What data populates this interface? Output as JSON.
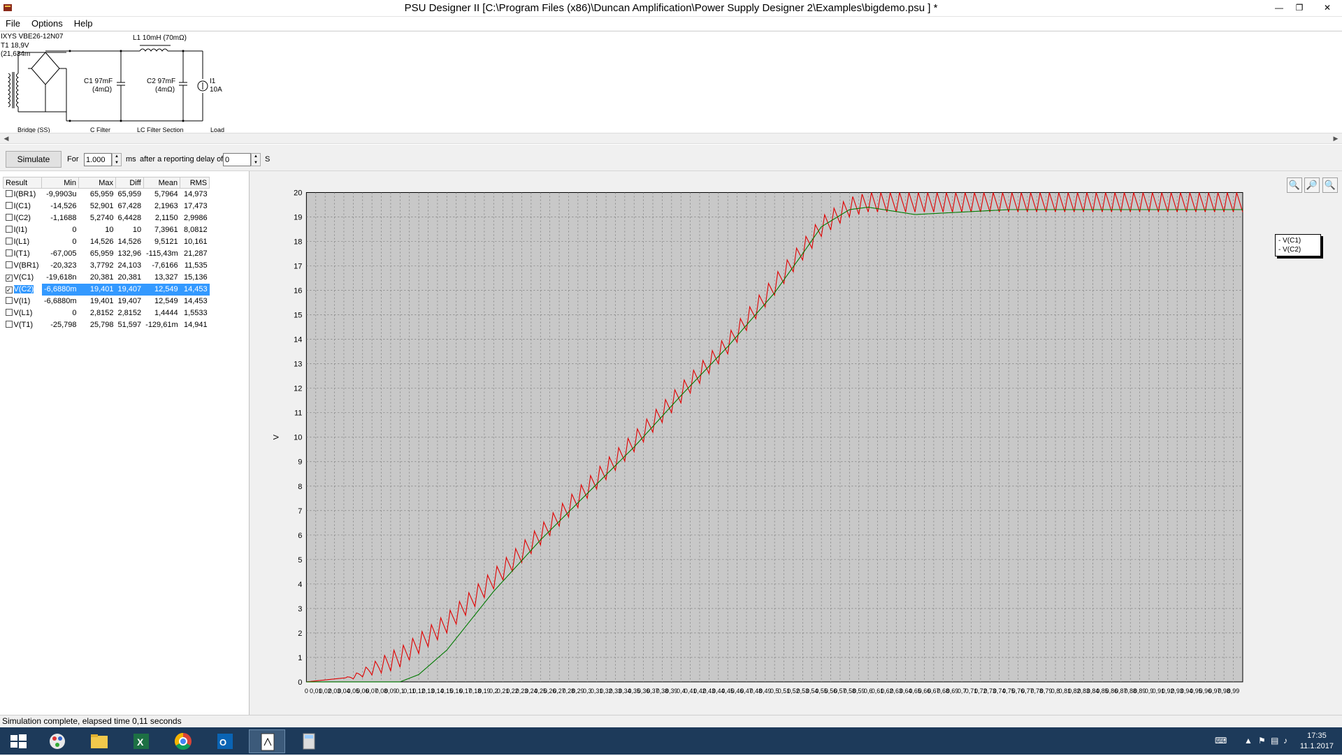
{
  "window": {
    "title": "PSU Designer II  [C:\\Program Files (x86)\\Duncan Amplification\\Power Supply Designer 2\\Examples\\bigdemo.psu ] *",
    "minimize_icon": "minimize-icon",
    "restore_icon": "restore-icon",
    "close_icon": "close-icon"
  },
  "menu": [
    "File",
    "Options",
    "Help"
  ],
  "schematic": {
    "rectifier": "IXYS  VBE26-12N07",
    "transformer_line1": "T1 18,9V",
    "transformer_line2": "(21,634m",
    "inductor": "L1 10mH (70mΩ)",
    "c1_line1": "C1 97mF",
    "c1_line2": "(4mΩ)",
    "c2_line1": "C2 97mF",
    "c2_line2": "(4mΩ)",
    "load_line1": "I1",
    "load_line2": "10A",
    "section_bridge": "Bridge (SS)",
    "section_cfilter": "C Filter",
    "section_lc": "LC Filter Section",
    "section_load": "Load"
  },
  "toolbar": {
    "simulate_label": "Simulate",
    "for_label": "For",
    "duration_value": "1.000",
    "ms_label": "ms",
    "delay_label": "after a reporting delay of",
    "delay_value": "0",
    "s_label": "S"
  },
  "results": {
    "headers": [
      "Result",
      "Min",
      "Max",
      "Diff",
      "Mean",
      "RMS"
    ],
    "rows": [
      {
        "checked": false,
        "name": "I(BR1)",
        "min": "-9,9903u",
        "max": "65,959",
        "diff": "65,959",
        "mean": "5,7964",
        "rms": "14,973"
      },
      {
        "checked": false,
        "name": "I(C1)",
        "min": "-14,526",
        "max": "52,901",
        "diff": "67,428",
        "mean": "2,1963",
        "rms": "17,473"
      },
      {
        "checked": false,
        "name": "I(C2)",
        "min": "-1,1688",
        "max": "5,2740",
        "diff": "6,4428",
        "mean": "2,1150",
        "rms": "2,9986"
      },
      {
        "checked": false,
        "name": "I(I1)",
        "min": "0",
        "max": "10",
        "diff": "10",
        "mean": "7,3961",
        "rms": "8,0812"
      },
      {
        "checked": false,
        "name": "I(L1)",
        "min": "0",
        "max": "14,526",
        "diff": "14,526",
        "mean": "9,5121",
        "rms": "10,161"
      },
      {
        "checked": false,
        "name": "I(T1)",
        "min": "-67,005",
        "max": "65,959",
        "diff": "132,96",
        "mean": "-115,43m",
        "rms": "21,287"
      },
      {
        "checked": false,
        "name": "V(BR1)",
        "min": "-20,323",
        "max": "3,7792",
        "diff": "24,103",
        "mean": "-7,6166",
        "rms": "11,535"
      },
      {
        "checked": true,
        "name": "V(C1)",
        "min": "-19,618n",
        "max": "20,381",
        "diff": "20,381",
        "mean": "13,327",
        "rms": "15,136"
      },
      {
        "checked": true,
        "name": "V(C2)",
        "min": "-6,6880m",
        "max": "19,401",
        "diff": "19,407",
        "mean": "12,549",
        "rms": "14,453",
        "selected": true
      },
      {
        "checked": false,
        "name": "V(I1)",
        "min": "-6,6880m",
        "max": "19,401",
        "diff": "19,407",
        "mean": "12,549",
        "rms": "14,453"
      },
      {
        "checked": false,
        "name": "V(L1)",
        "min": "0",
        "max": "2,8152",
        "diff": "2,8152",
        "mean": "1,4444",
        "rms": "1,5533"
      },
      {
        "checked": false,
        "name": "V(T1)",
        "min": "-25,798",
        "max": "25,798",
        "diff": "51,597",
        "mean": "-129,61m",
        "rms": "14,941"
      }
    ]
  },
  "chart_data": {
    "type": "line",
    "ylabel": "V",
    "xlabel": "",
    "ylim": [
      0,
      20
    ],
    "xlim": [
      0,
      1.0
    ],
    "y_ticks": [
      "0",
      "1",
      "2",
      "3",
      "4",
      "5",
      "6",
      "7",
      "8",
      "9",
      "10",
      "11",
      "12",
      "13",
      "14",
      "15",
      "16",
      "17",
      "18",
      "19",
      "20"
    ],
    "x_ticks": [
      "0",
      "0,01",
      "0,02",
      "0,03",
      "0,04",
      "0,05",
      "0,06",
      "0,07",
      "0,08",
      "0,09",
      "0,1",
      "0,11",
      "0,12",
      "0,13",
      "0,14",
      "0,15",
      "0,16",
      "0,17",
      "0,18",
      "0,19",
      "0,2",
      "0,21",
      "0,22",
      "0,23",
      "0,24",
      "0,25",
      "0,26",
      "0,27",
      "0,28",
      "0,29",
      "0,3",
      "0,31",
      "0,32",
      "0,33",
      "0,34",
      "0,35",
      "0,36",
      "0,37",
      "0,38",
      "0,39",
      "0,4",
      "0,41",
      "0,42",
      "0,43",
      "0,44",
      "0,45",
      "0,46",
      "0,47",
      "0,48",
      "0,49",
      "0,5",
      "0,51",
      "0,52",
      "0,53",
      "0,54",
      "0,55",
      "0,56",
      "0,57",
      "0,58",
      "0,59",
      "0,6",
      "0,61",
      "0,62",
      "0,63",
      "0,64",
      "0,65",
      "0,66",
      "0,67",
      "0,68",
      "0,69",
      "0,7",
      "0,71",
      "0,72",
      "0,73",
      "0,74",
      "0,75",
      "0,76",
      "0,77",
      "0,78",
      "0,79",
      "0,8",
      "0,81",
      "0,82",
      "0,83",
      "0,84",
      "0,85",
      "0,86",
      "0,87",
      "0,88",
      "0,89",
      "0,9",
      "0,91",
      "0,92",
      "0,93",
      "0,94",
      "0,95",
      "0,96",
      "0,97",
      "0,98",
      "0,99"
    ],
    "grid": true,
    "legend_position": "right",
    "series": [
      {
        "name": "V(C1)",
        "color": "#e00000",
        "x": [
          0,
          0.05,
          0.1,
          0.15,
          0.2,
          0.25,
          0.3,
          0.35,
          0.4,
          0.45,
          0.5,
          0.55,
          0.58,
          0.6,
          0.65,
          0.7,
          0.75,
          0.8,
          0.85,
          0.9,
          0.95,
          1.0
        ],
        "y": [
          0,
          0.2,
          1.0,
          2.4,
          4.2,
          6.0,
          7.9,
          9.8,
          11.8,
          13.8,
          16.2,
          18.6,
          19.4,
          19.6,
          19.6,
          19.6,
          19.6,
          19.6,
          19.6,
          19.6,
          19.6,
          19.6
        ],
        "ripple": 0.8,
        "ripple_period": 0.01
      },
      {
        "name": "V(C2)",
        "color": "#007a00",
        "x": [
          0,
          0.1,
          0.12,
          0.15,
          0.2,
          0.25,
          0.3,
          0.35,
          0.4,
          0.45,
          0.5,
          0.53,
          0.55,
          0.58,
          0.6,
          0.65,
          0.7,
          0.75,
          0.8,
          0.9,
          1.0
        ],
        "y": [
          0,
          0,
          0.3,
          1.3,
          3.7,
          5.8,
          7.7,
          9.6,
          11.7,
          13.7,
          15.9,
          17.5,
          18.6,
          19.3,
          19.4,
          19.1,
          19.2,
          19.3,
          19.3,
          19.3,
          19.3
        ]
      }
    ]
  },
  "zoom": {
    "zoom_in_icon": "zoom-in-icon",
    "zoom_out_icon": "zoom-out-icon",
    "zoom_reset_icon": "zoom-reset-icon"
  },
  "status": {
    "text": "Simulation complete, elapsed time 0,11 seconds"
  },
  "taskbar": {
    "time": "17:35",
    "date": "11.1.2017",
    "apps": [
      "windows-start-icon",
      "paint-icon",
      "file-explorer-icon",
      "excel-icon",
      "chrome-icon",
      "outlook-icon",
      "psu-designer-icon",
      "calculator-icon"
    ]
  }
}
